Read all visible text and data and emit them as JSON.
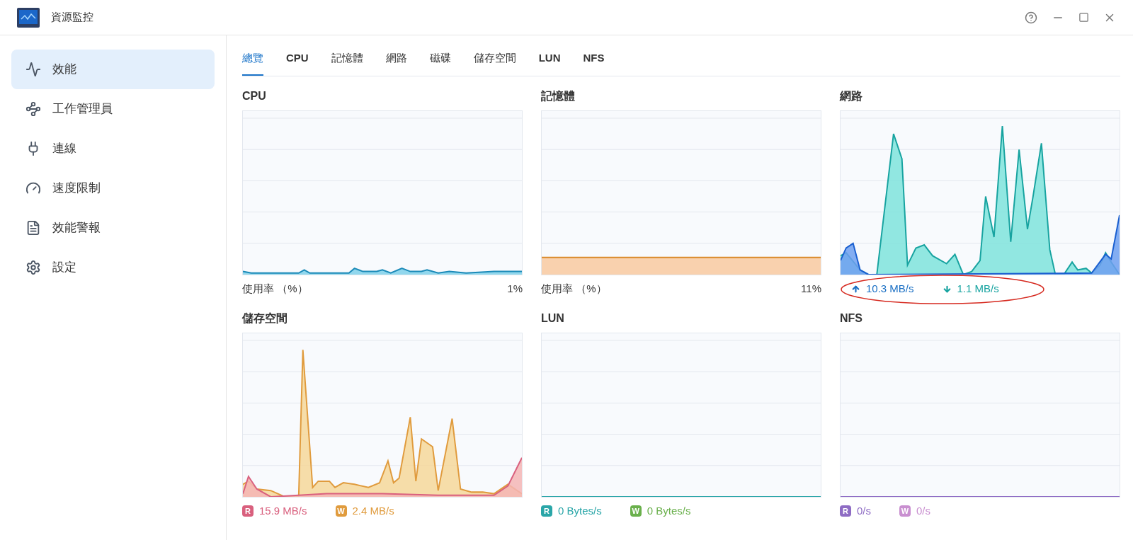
{
  "window": {
    "title": "資源監控"
  },
  "sidebar": {
    "items": [
      {
        "label": "效能",
        "selected": true
      },
      {
        "label": "工作管理員",
        "selected": false
      },
      {
        "label": "連線",
        "selected": false
      },
      {
        "label": "速度限制",
        "selected": false
      },
      {
        "label": "效能警報",
        "selected": false
      },
      {
        "label": "設定",
        "selected": false
      }
    ]
  },
  "tabs": [
    {
      "label": "總覽",
      "selected": true
    },
    {
      "label": "CPU",
      "selected": false
    },
    {
      "label": "記憶體",
      "selected": false
    },
    {
      "label": "網路",
      "selected": false
    },
    {
      "label": "磁碟",
      "selected": false
    },
    {
      "label": "儲存空間",
      "selected": false
    },
    {
      "label": "LUN",
      "selected": false
    },
    {
      "label": "NFS",
      "selected": false
    }
  ],
  "panels": [
    {
      "title": "CPU",
      "kind": "usage",
      "label": "使用率 （%）",
      "reading": "1%"
    },
    {
      "title": "記憶體",
      "kind": "usage",
      "label": "使用率 （%）",
      "reading": "11%"
    },
    {
      "title": "網路",
      "kind": "network",
      "circled": true,
      "legend": [
        {
          "kind": "up",
          "value": "10.3 MB/s",
          "color": "#1a6fc4"
        },
        {
          "kind": "down",
          "value": "1.1 MB/s",
          "color": "#17a3a0"
        }
      ]
    },
    {
      "title": "儲存空間",
      "kind": "io",
      "legend": [
        {
          "badge": "R",
          "value": "15.9 MB/s",
          "color": "#d9607e"
        },
        {
          "badge": "W",
          "value": "2.4 MB/s",
          "color": "#e09b3d"
        }
      ]
    },
    {
      "title": "LUN",
      "kind": "io",
      "legend": [
        {
          "badge": "R",
          "value": "0 Bytes/s",
          "color": "#2aa6a8"
        },
        {
          "badge": "W",
          "value": "0 Bytes/s",
          "color": "#6ab04c"
        }
      ]
    },
    {
      "title": "NFS",
      "kind": "io",
      "legend": [
        {
          "badge": "R",
          "value": "0/s",
          "color": "#8e6cc4"
        },
        {
          "badge": "W",
          "value": "0/s",
          "color": "#c98fd0"
        }
      ]
    }
  ]
}
